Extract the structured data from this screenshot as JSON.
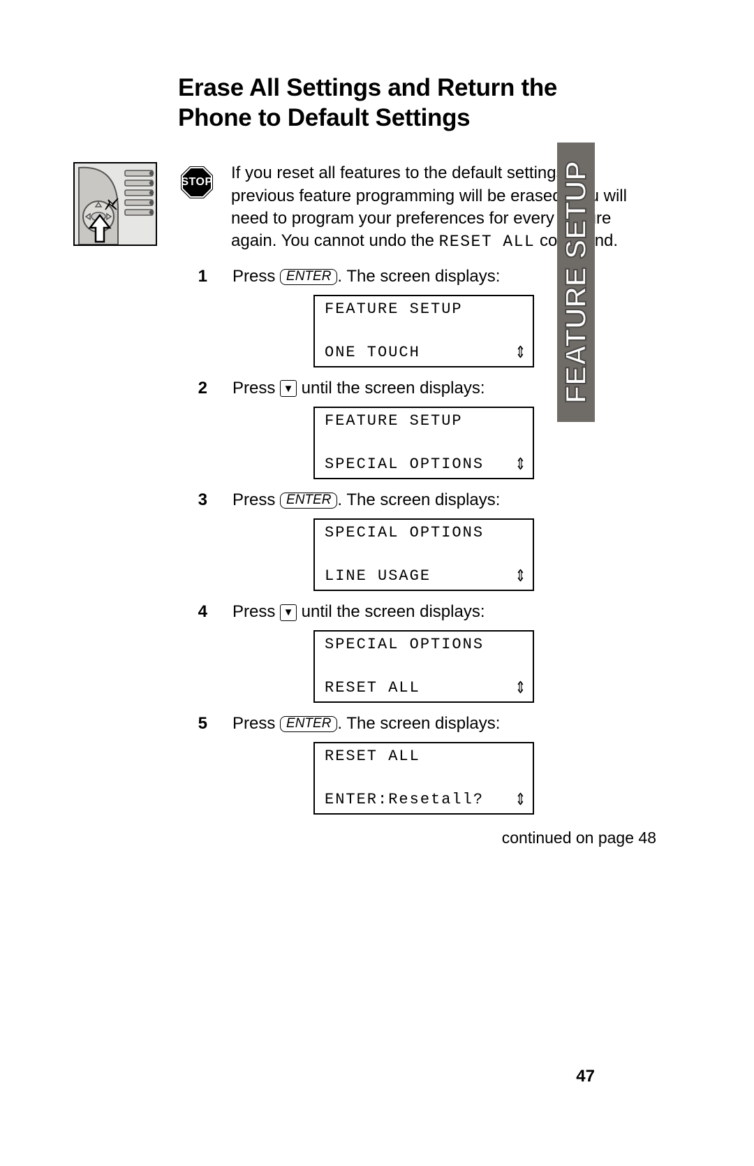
{
  "title": "Erase All Settings and Return the Phone to Default Settings",
  "side_tab": "FEATURE SETUP",
  "stop_label": "STOP",
  "warning": {
    "before": "If you reset all features to the default settings, all previous feature programming will be erased. You will need to program your preferences for every feature again. You cannot undo the ",
    "cmd": "RESET ALL",
    "after": " command."
  },
  "keys": {
    "enter": "ENTER",
    "down": "▼"
  },
  "steps": [
    {
      "n": "1",
      "pre": "Press ",
      "key": "enter",
      "post": ". The screen displays:",
      "lcd": {
        "line1": "FEATURE SETUP",
        "line2": "ONE TOUCH",
        "arrows": "⇕"
      }
    },
    {
      "n": "2",
      "pre": "Press ",
      "key": "down",
      "post": " until the screen displays:",
      "lcd": {
        "line1": "FEATURE SETUP",
        "line2": "SPECIAL OPTIONS",
        "arrows": "⇕"
      }
    },
    {
      "n": "3",
      "pre": "Press ",
      "key": "enter",
      "post": ". The screen displays:",
      "lcd": {
        "line1": "SPECIAL OPTIONS",
        "line2": "LINE USAGE",
        "arrows": "⇕"
      }
    },
    {
      "n": "4",
      "pre": "Press ",
      "key": "down",
      "post": " until the screen displays:",
      "lcd": {
        "line1": "SPECIAL OPTIONS",
        "line2": "RESET ALL",
        "arrows": "⇕"
      }
    },
    {
      "n": "5",
      "pre": "Press ",
      "key": "enter",
      "post": ". The screen displays:",
      "lcd": {
        "line1": "RESET ALL",
        "line2": "ENTER:Resetall?",
        "arrows": "⇕"
      }
    }
  ],
  "continued": "continued on page 48",
  "page_number": "47"
}
